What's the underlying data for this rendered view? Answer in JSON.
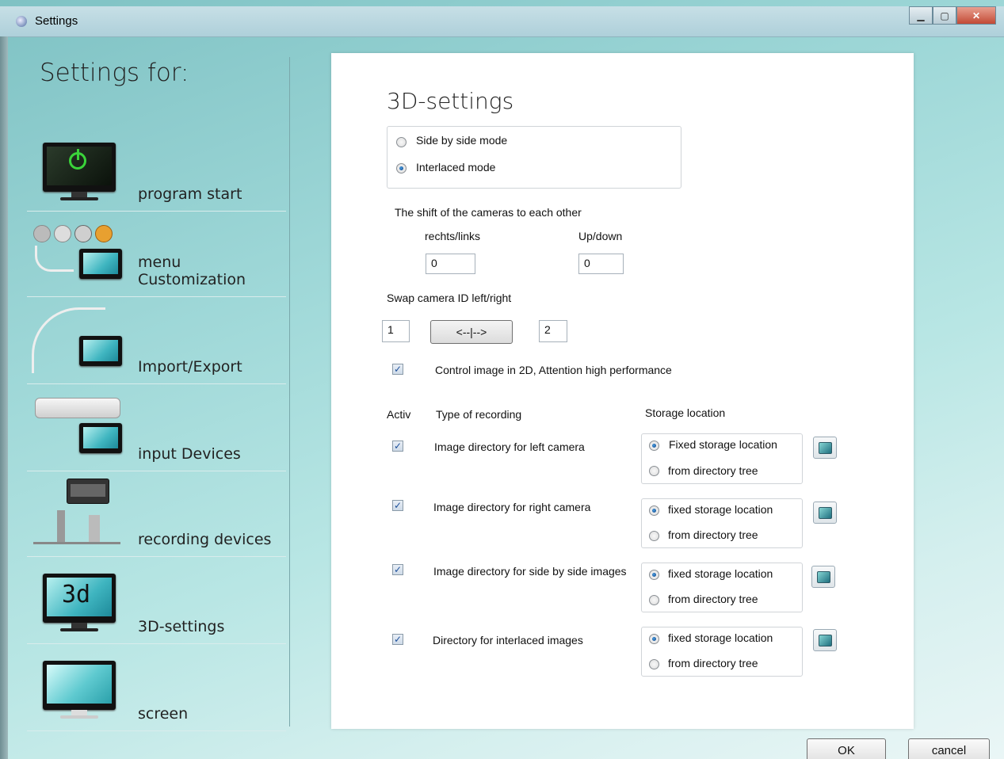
{
  "window": {
    "title": "Settings"
  },
  "sidebar": {
    "title": "Settings for:",
    "items": [
      {
        "label": "program start"
      },
      {
        "label": "menu Customization"
      },
      {
        "label": "Import/Export"
      },
      {
        "label": "input Devices"
      },
      {
        "label": "recording devices"
      },
      {
        "label": "3D-settings"
      },
      {
        "label": "screen"
      }
    ]
  },
  "main": {
    "heading": "3D-settings",
    "mode": {
      "options": [
        "Side by side mode",
        "Interlaced mode"
      ],
      "selected": "Interlaced mode"
    },
    "shift": {
      "label": "The shift of the cameras to each other",
      "rl_label": "rechts/links",
      "rl_value": "0",
      "ud_label": "Up/down",
      "ud_value": "0"
    },
    "swap": {
      "label": "Swap camera ID left/right",
      "left_value": "1",
      "button_label": "<--|-->",
      "right_value": "2"
    },
    "control_image": {
      "checked": true,
      "label": "Control image in 2D, Attention high performance"
    },
    "table": {
      "col_activ": "Activ",
      "col_type": "Type of recording",
      "col_storage": "Storage location",
      "rows": [
        {
          "checked": true,
          "type": "Image directory for left camera",
          "opt1": "Fixed storage location",
          "opt2": "from directory tree",
          "selected": 1
        },
        {
          "checked": true,
          "type": "Image directory for right camera",
          "opt1": "fixed storage location",
          "opt2": "from directory tree",
          "selected": 1
        },
        {
          "checked": true,
          "type": "Image directory for side by side images",
          "opt1": "fixed storage location",
          "opt2": "from directory tree",
          "selected": 1
        },
        {
          "checked": true,
          "type": "Directory for interlaced images",
          "opt1": "fixed storage location",
          "opt2": "from directory tree",
          "selected": 1
        }
      ]
    }
  },
  "buttons": {
    "ok": "OK",
    "cancel": "cancel"
  },
  "colors": {
    "accent": "#3fb5c0",
    "background": "#9fd8d8"
  }
}
